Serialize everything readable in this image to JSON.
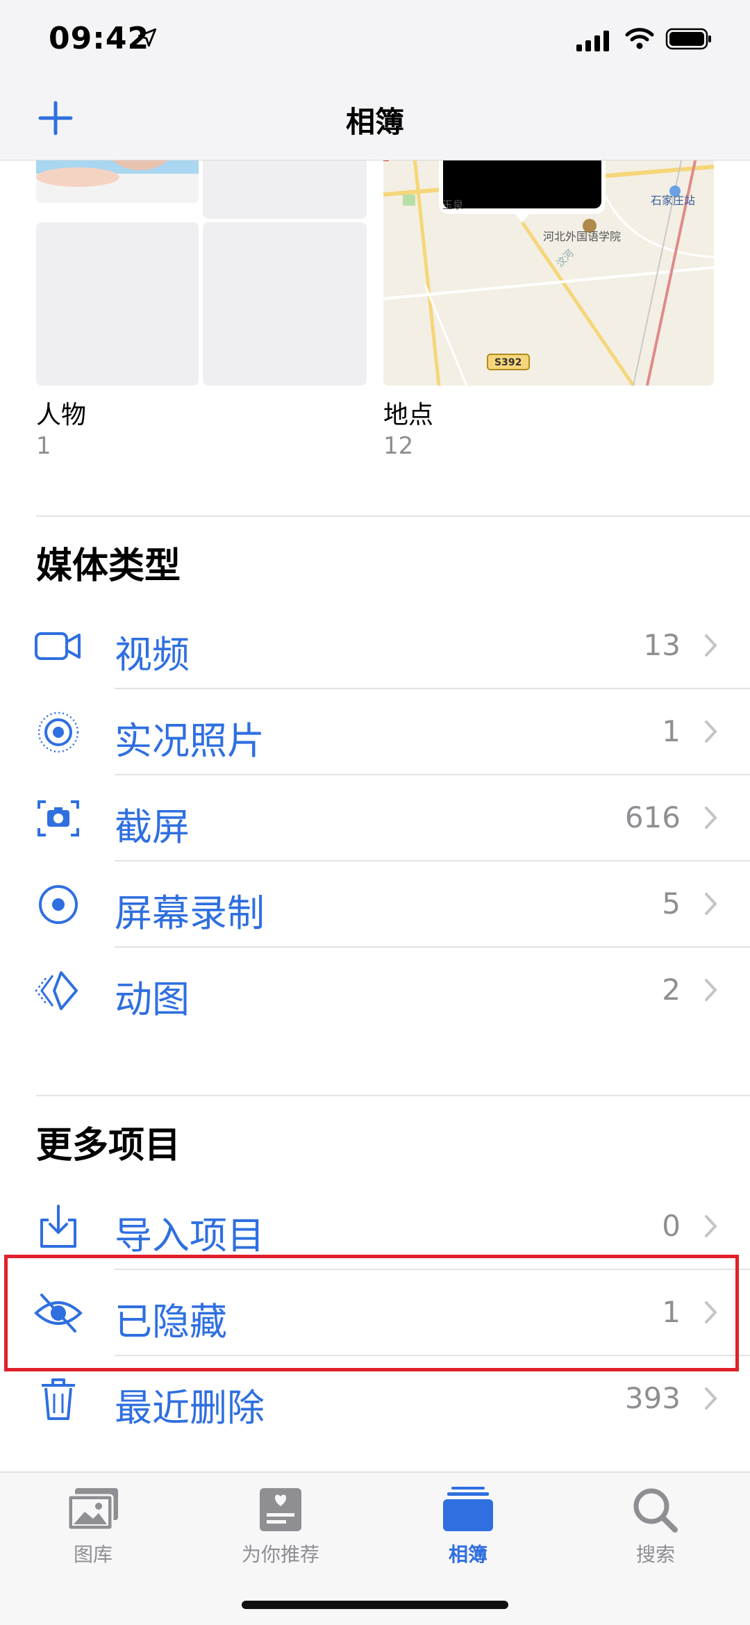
{
  "status": {
    "time": "09:42"
  },
  "nav": {
    "title": "相簿",
    "add_icon": "plus-icon"
  },
  "albums": {
    "people": {
      "label": "人物",
      "count": "1"
    },
    "places": {
      "label": "地点",
      "count": "12",
      "map_labels": [
        "玉泉",
        "石家庄站",
        "河北外国语学院",
        "S392",
        "汶河"
      ]
    }
  },
  "media_types": {
    "title": "媒体类型",
    "items": [
      {
        "label": "视频",
        "count": "13",
        "icon": "video-icon"
      },
      {
        "label": "实况照片",
        "count": "1",
        "icon": "live-photo-icon"
      },
      {
        "label": "截屏",
        "count": "616",
        "icon": "screenshot-icon"
      },
      {
        "label": "屏幕录制",
        "count": "5",
        "icon": "screen-recording-icon"
      },
      {
        "label": "动图",
        "count": "2",
        "icon": "animated-icon"
      }
    ]
  },
  "more": {
    "title": "更多项目",
    "items": [
      {
        "label": "导入项目",
        "count": "0",
        "icon": "import-icon"
      },
      {
        "label": "已隐藏",
        "count": "1",
        "icon": "hidden-eye-icon"
      },
      {
        "label": "最近删除",
        "count": "393",
        "icon": "trash-icon"
      }
    ]
  },
  "tabbar": {
    "tabs": [
      {
        "label": "图库",
        "icon": "photos-icon"
      },
      {
        "label": "为你推荐",
        "icon": "for-you-icon"
      },
      {
        "label": "相簿",
        "icon": "albums-icon",
        "active": true
      },
      {
        "label": "搜索",
        "icon": "search-icon"
      }
    ]
  },
  "colors": {
    "accent": "#2f6fe0",
    "highlight": "#e0202a",
    "secondary_text": "#8e8e93"
  }
}
